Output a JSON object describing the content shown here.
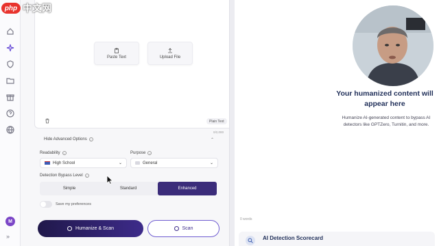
{
  "watermark": {
    "logo": "php",
    "text": "中文网"
  },
  "sidebar": {
    "items": [
      "home-icon",
      "sparkle-icon",
      "shield-icon",
      "folder-icon",
      "gift-icon",
      "help-icon",
      "globe-icon"
    ],
    "avatar_initial": "M",
    "expand_icon": "»"
  },
  "editor": {
    "paste_label": "Paste Text",
    "upload_label": "Upload File",
    "mode_badge": "Plain Text",
    "counter": "0/2,000"
  },
  "advanced": {
    "toggle_label": "Hide Advanced Options",
    "readability_label": "Readability",
    "readability_value": "High School",
    "purpose_label": "Purpose",
    "purpose_value": "General",
    "bypass_label": "Detection Bypass Level",
    "levels": [
      "Simple",
      "Standard",
      "Enhanced"
    ],
    "active_level": "Enhanced",
    "save_prefs_label": "Save my preferences"
  },
  "actions": {
    "humanize_scan": "Humanize & Scan",
    "scan": "Scan"
  },
  "output": {
    "title": "Your humanized content will appear here",
    "description": "Humanize AI-generated content to bypass AI detectors like GPTZero, Turnitin, and more.",
    "words": "0 words",
    "scorecard_title": "AI Detection Scorecard"
  },
  "colors": {
    "accent": "#3b2c7a",
    "title": "#1f2e58"
  }
}
